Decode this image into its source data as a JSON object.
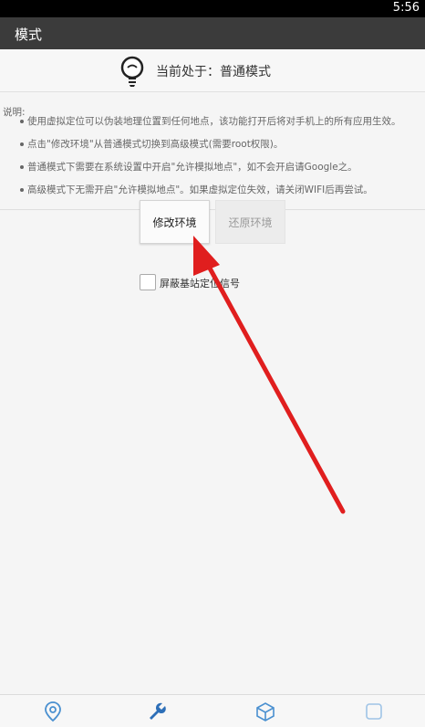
{
  "status_bar": {
    "time": "5:56"
  },
  "app_bar": {
    "title": "模式"
  },
  "header": {
    "mode_text": "当前处于：普通模式"
  },
  "description": {
    "title": "说明:",
    "items": [
      "使用虚拟定位可以伪装地理位置到任何地点，该功能打开后将对手机上的所有应用生效。",
      "点击\"修改环境\"从普通模式切换到高级模式(需要root权限)。",
      "普通模式下需要在系统设置中开启\"允许模拟地点\"，如不会开启请Google之。",
      "高级模式下无需开启\"允许模拟地点\"。如果虚拟定位失效，请关闭WIFI后再尝试。"
    ]
  },
  "buttons": {
    "modify": "修改环境",
    "restore": "还原环境"
  },
  "checkbox": {
    "label": "屏蔽基站定位信号",
    "checked": false
  },
  "bottom_nav": {
    "icons": [
      "location-pin-icon",
      "wrench-icon",
      "box-icon",
      "app-icon"
    ],
    "active": "wrench-icon"
  },
  "colors": {
    "annotation_arrow": "#e01e1e",
    "active_icon": "#2d6fb8",
    "inactive_icon": "#4a90d0"
  }
}
